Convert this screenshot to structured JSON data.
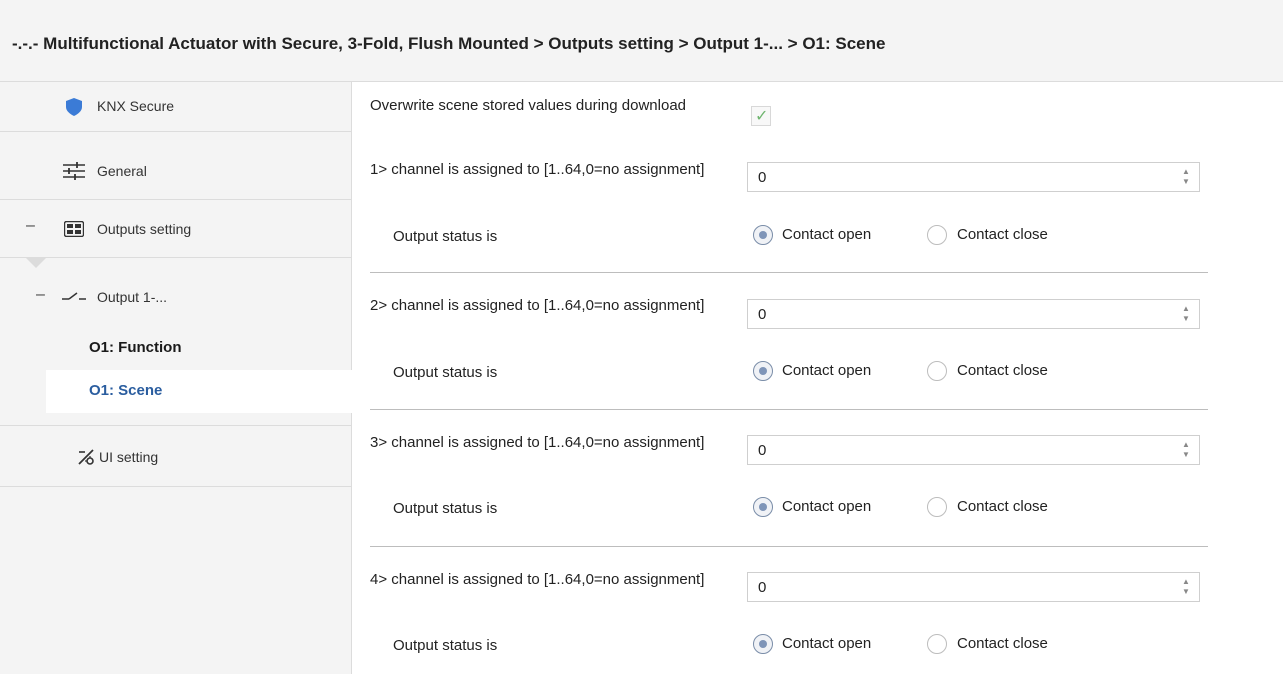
{
  "header": {
    "breadcrumb": "-.-.- Multifunctional Actuator with Secure, 3-Fold, Flush Mounted > Outputs setting > Output 1-... > O1: Scene"
  },
  "sidebar": {
    "items": [
      {
        "label": "KNX Secure",
        "icon": "shield-icon"
      },
      {
        "label": "General",
        "icon": "sliders-icon"
      },
      {
        "label": "Outputs setting",
        "icon": "grid-icon",
        "expanded": true
      },
      {
        "label": "Output 1-...",
        "icon": "switch-icon",
        "expanded": true
      },
      {
        "label": "O1: Function"
      },
      {
        "label": "O1: Scene",
        "active": true
      },
      {
        "label": "UI setting",
        "icon": "ui-setting-icon"
      }
    ],
    "collapse_symbol": "–"
  },
  "main": {
    "overwrite": {
      "label": "Overwrite scene stored values during download",
      "checked": true
    },
    "channels": [
      {
        "label": "1> channel is assigned to [1..64,0=no assignment]",
        "value": "0",
        "status_label": "Output status is",
        "selected": "Contact open"
      },
      {
        "label": "2> channel is assigned to [1..64,0=no assignment]",
        "value": "0",
        "status_label": "Output status is",
        "selected": "Contact open"
      },
      {
        "label": "3> channel is assigned to [1..64,0=no assignment]",
        "value": "0",
        "status_label": "Output status is",
        "selected": "Contact open"
      },
      {
        "label": "4> channel is assigned to [1..64,0=no assignment]",
        "value": "0",
        "status_label": "Output status is",
        "selected": "Contact open"
      }
    ],
    "options": {
      "open": "Contact open",
      "close": "Contact close"
    }
  },
  "colors": {
    "accent": "#2a5d9f",
    "shield": "#3b7bd6",
    "check": "#6fb56f"
  }
}
